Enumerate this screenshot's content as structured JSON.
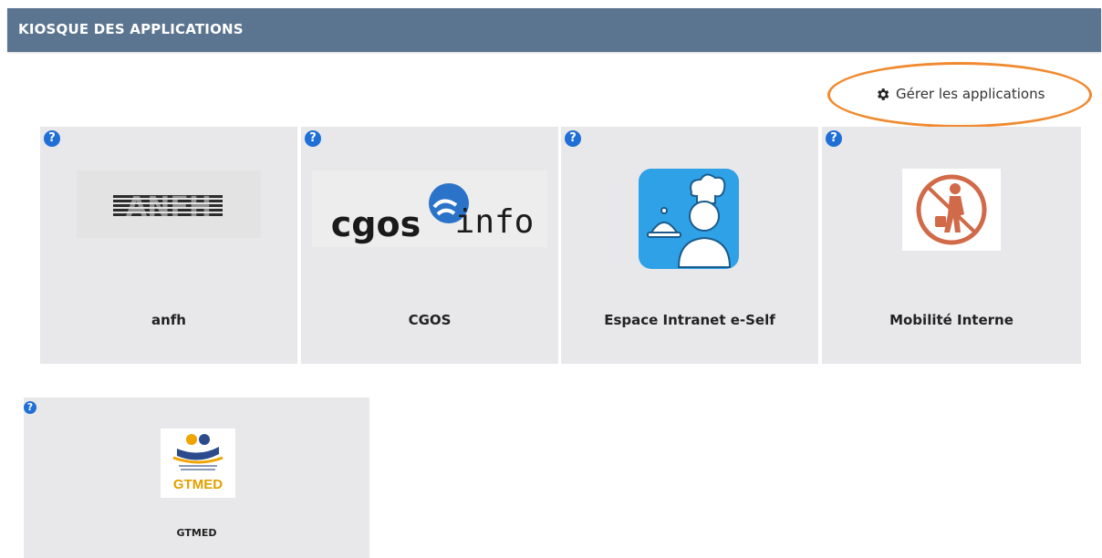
{
  "header": {
    "title": "KIOSQUE DES APPLICATIONS"
  },
  "manage": {
    "label": "Gérer les applications",
    "icon": "gear-icon",
    "highlight_color": "#f08a30"
  },
  "colors": {
    "header_bg": "#5b7490",
    "tile_bg": "#e8e8ea",
    "help_icon": "#1f6fd6"
  },
  "apps": [
    {
      "name": "anfh",
      "logo_text": "ANFH"
    },
    {
      "name": "CGOS",
      "logo_text_left": "cgos",
      "logo_text_right": "info"
    },
    {
      "name": "Espace Intranet e-Self"
    },
    {
      "name": "Mobilité Interne"
    },
    {
      "name": "GTMED",
      "logo_text": "GTMED"
    }
  ]
}
